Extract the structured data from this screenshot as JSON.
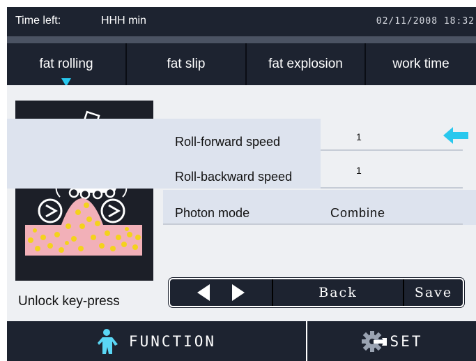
{
  "status": {
    "time_left_label": "Time left:",
    "time_left_value": "HHH  min",
    "datetime": "02/11/2008  18:32"
  },
  "tabs": [
    {
      "label": "fat rolling",
      "selected": true
    },
    {
      "label": "fat slip",
      "selected": false
    },
    {
      "label": "fat explosion",
      "selected": false
    },
    {
      "label": "work time",
      "selected": false
    }
  ],
  "settings": {
    "roll_forward": {
      "label": "Roll-forward speed",
      "value": "1"
    },
    "roll_backward": {
      "label": "Roll-backward speed",
      "value": "1"
    },
    "photon_mode": {
      "label": "Photon mode",
      "value": "Combine"
    }
  },
  "unlock_label": "Unlock key-press",
  "nav": {
    "back_label": "Back",
    "save_label": "Save"
  },
  "bottom": {
    "function_label": "FUNCTION",
    "set_label": "SET"
  },
  "colors": {
    "bar_bg": "#1d2330",
    "accent_cyan": "#28c8ee",
    "row_band": "#dde3ee",
    "fat_yellow": "#f4d21c",
    "skin_pink": "#f2b0b8"
  },
  "icons": {
    "selected_tab_marker": "caret-down-icon",
    "value_pointer": "arrow-left-icon",
    "prev": "triangle-left-icon",
    "next": "triangle-right-icon",
    "function": "person-icon",
    "set": "gear-wrench-icon"
  }
}
